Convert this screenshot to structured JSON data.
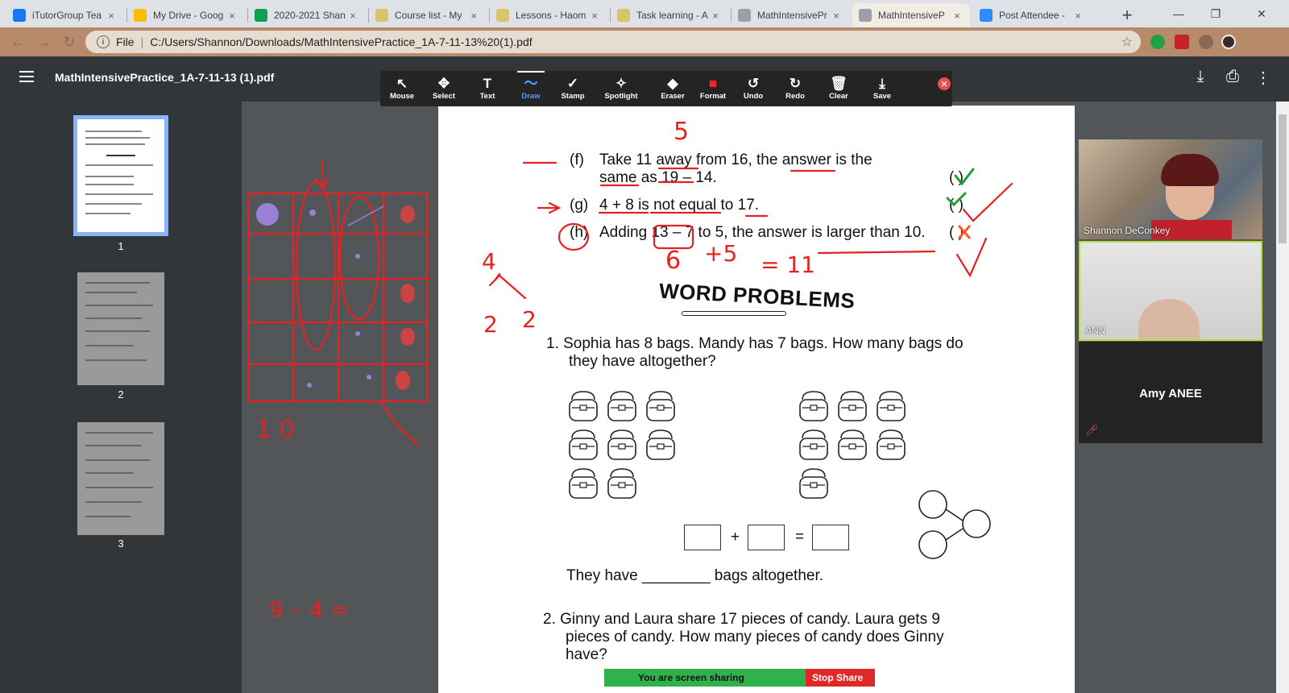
{
  "browser": {
    "tabs": [
      {
        "label": "iTutorGroup Tea",
        "icon": "facebook-icon",
        "color": "#1877f2"
      },
      {
        "label": "My Drive - Goog",
        "icon": "google-drive-icon",
        "color": "#fbbc04"
      },
      {
        "label": "2020-2021 Shan",
        "icon": "google-sheets-icon",
        "color": "#0f9d58"
      },
      {
        "label": "Course list - My",
        "icon": "course-icon",
        "color": "#d8c46a"
      },
      {
        "label": "Lessons - Haom",
        "icon": "lessons-icon",
        "color": "#d8c46a"
      },
      {
        "label": "Task learning - A",
        "icon": "task-icon",
        "color": "#d8c46a"
      },
      {
        "label": "MathIntensivePr",
        "icon": "globe-icon",
        "color": "#9aa0a6"
      },
      {
        "label": "MathIntensiveP",
        "icon": "pdf-icon",
        "color": "#9aa0a6"
      },
      {
        "label": "Post Attendee -",
        "icon": "zoom-icon",
        "color": "#2d8cff"
      }
    ],
    "tab_close": "×",
    "new_tab": "+",
    "window_min": "—",
    "window_restore": "❐",
    "window_close": "✕",
    "address": {
      "scheme_label": "File",
      "url": "C:/Users/Shannon/Downloads/MathIntensivePractice_1A-7-11-13%20(1).pdf"
    }
  },
  "pdf": {
    "title": "MathIntensivePractice_1A-7-11-13 (1).pdf",
    "thumb_numbers": [
      "1",
      "2",
      "3"
    ]
  },
  "annotate_toolbar": {
    "tools": [
      {
        "label": "Mouse",
        "glyph": "↖"
      },
      {
        "label": "Select",
        "glyph": "✥"
      },
      {
        "label": "Text",
        "glyph": "T"
      },
      {
        "label": "Draw",
        "glyph": "〜"
      },
      {
        "label": "Stamp",
        "glyph": "✓"
      },
      {
        "label": "Spotlight",
        "glyph": "✧"
      },
      {
        "label": "Eraser",
        "glyph": "◆"
      },
      {
        "label": "Format",
        "glyph": "■"
      },
      {
        "label": "Undo",
        "glyph": "↺"
      },
      {
        "label": "Redo",
        "glyph": "↻"
      },
      {
        "label": "Clear",
        "glyph": "🗑"
      },
      {
        "label": "Save",
        "glyph": "⤓"
      }
    ],
    "selected": "Draw",
    "format_color": "#ff2020"
  },
  "worksheet": {
    "item_f_label": "(f)",
    "item_f_line1": "Take 11 away from 16, the answer is the",
    "item_f_line2": "same as 19 – 14.",
    "item_g_label": "(g)",
    "item_g_text": "4 + 8 is not equal to 17.",
    "item_h_label": "(h)",
    "item_h_text": "Adding 13 – 7 to 5, the answer is larger than 10.",
    "paren_f": "(      )",
    "paren_g": "(      )",
    "paren_h": "(      )",
    "section_title": "WORD PROBLEMS",
    "q1_line1": "1.  Sophia has 8 bags. Mandy has 7 bags. How many bags do",
    "q1_line2": "they have altogether?",
    "plus": "+",
    "equals": "=",
    "they_have": "They have ________ bags altogether.",
    "q2_line1": "2.  Ginny and Laura share 17 pieces of candy. Laura gets 9",
    "q2_line2": "pieces of candy. How many pieces of candy does Ginny",
    "q2_line3": "have?"
  },
  "ink": {
    "n5": "5",
    "n4": "4",
    "n2a": "2",
    "n2b": "2",
    "n6": "6",
    "plus5": "+5",
    "eq11": "= 11",
    "n10": "1 0",
    "expr": "9 – 4 =",
    "color": "#e52222"
  },
  "zoom": {
    "participant1": "Shannon DeConkey",
    "participant2": "ANN",
    "participant3": "Amy ANEE",
    "sharing_text": "You are screen sharing",
    "stop_share": "Stop Share"
  }
}
